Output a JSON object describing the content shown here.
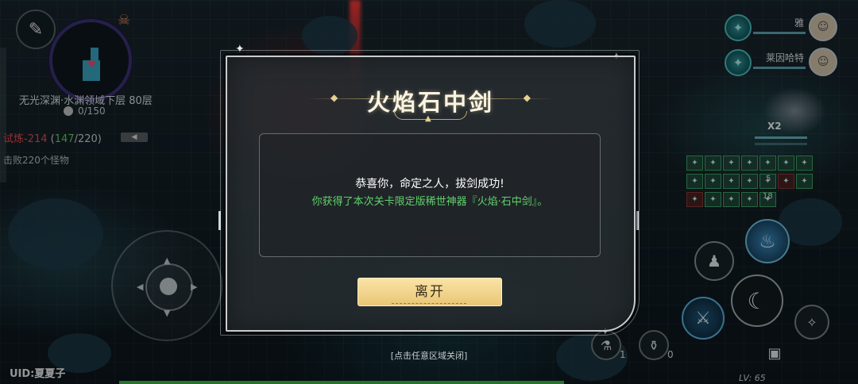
{
  "hud": {
    "floor_title": "无光深渊·水渊领域下层 80层",
    "floor_progress": "0/150",
    "trial_label": "试炼-214",
    "trial_progress_open": " (",
    "trial_progress_current": "147",
    "trial_progress_total": "/220)",
    "kill_task": "击败220个怪物",
    "uid_label": "UID:",
    "uid_value": "夏夏子",
    "level": "LV: 65",
    "multiplier": "X2",
    "potion_red_count": "1",
    "potion_gray_count": "0"
  },
  "party": [
    {
      "name": "雅"
    },
    {
      "name": "莱因哈特"
    }
  ],
  "buffs": {
    "count_a": "5",
    "count_b": "18"
  },
  "modal": {
    "title": "火焰石中剑",
    "message_line1": "恭喜你，命定之人，拔剑成功!",
    "message_line2": "你获得了本次关卡限定版稀世神器『火焰·石中剑』。",
    "leave_button": "离开",
    "dismiss_hint": "[点击任意区域关闭]"
  },
  "icons": {
    "feather": "feather-icon",
    "skull": "skull-icon",
    "fire_skill": "fire-skill-icon",
    "sword_skill": "crossed-swords-icon"
  },
  "colors": {
    "accent_gold": "#e8c676",
    "success_green": "#5fd16b",
    "trial_red": "#ef4d4d"
  }
}
